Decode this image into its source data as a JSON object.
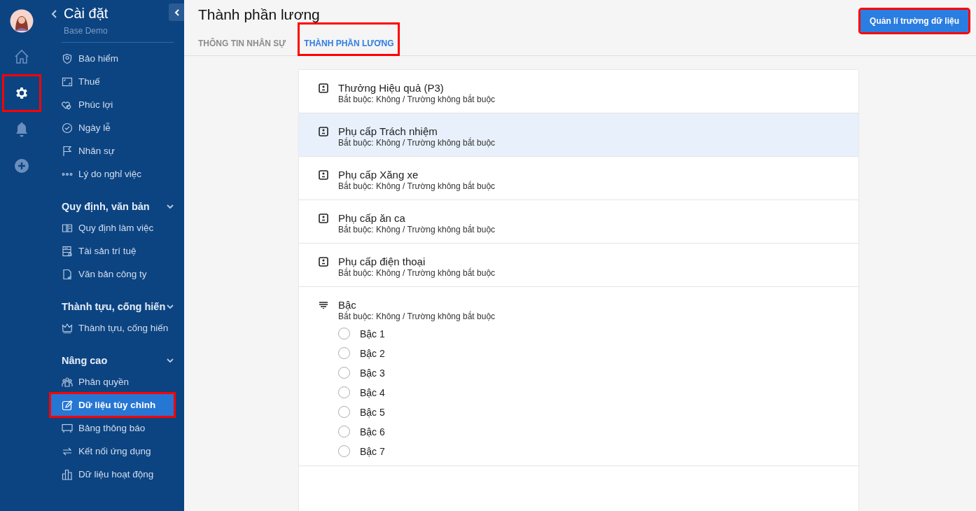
{
  "rail": {
    "items": [
      {
        "kind": "home",
        "selected": false,
        "highlighted": false
      },
      {
        "kind": "settings",
        "selected": true,
        "highlighted": true
      },
      {
        "kind": "bell",
        "selected": false,
        "highlighted": false
      },
      {
        "kind": "add",
        "selected": false,
        "highlighted": false
      }
    ]
  },
  "sidebar": {
    "title": "Cài đặt",
    "subtitle": "Base Demo",
    "sections": [
      {
        "items": [
          {
            "label": "Bảo hiểm",
            "kind": "shield",
            "selected": false,
            "highlighted": false
          },
          {
            "label": "Thuế",
            "kind": "frame",
            "selected": false,
            "highlighted": false
          },
          {
            "label": "Phúc lợi",
            "kind": "hearts",
            "selected": false,
            "highlighted": false
          },
          {
            "label": "Ngày lễ",
            "kind": "check",
            "selected": false,
            "highlighted": false
          },
          {
            "label": "Nhân sự",
            "kind": "flag",
            "selected": false,
            "highlighted": false
          },
          {
            "label": "Lý do nghỉ việc",
            "kind": "dots",
            "selected": false,
            "highlighted": false
          }
        ]
      },
      {
        "heading": "Quy định, văn bản",
        "expanded": true,
        "items": [
          {
            "label": "Quy định làm việc",
            "kind": "book",
            "selected": false,
            "highlighted": false
          },
          {
            "label": "Tài sản trí tuệ",
            "kind": "list",
            "selected": false,
            "highlighted": false
          },
          {
            "label": "Văn bản công ty",
            "kind": "doc",
            "selected": false,
            "highlighted": false
          }
        ]
      },
      {
        "heading": "Thành tựu, cống hiến",
        "expanded": true,
        "items": [
          {
            "label": "Thành tựu, cống hiến",
            "kind": "crown",
            "selected": false,
            "highlighted": false
          }
        ]
      },
      {
        "heading": "Nâng cao",
        "expanded": true,
        "items": [
          {
            "label": "Phân quyền",
            "kind": "people",
            "selected": false,
            "highlighted": false
          },
          {
            "label": "Dữ liệu tùy chỉnh",
            "kind": "edit",
            "selected": true,
            "highlighted": true
          },
          {
            "label": "Bảng thông báo",
            "kind": "board",
            "selected": false,
            "highlighted": false
          },
          {
            "label": "Kết nối ứng dụng",
            "kind": "swap",
            "selected": false,
            "highlighted": false
          },
          {
            "label": "Dữ liệu hoạt động",
            "kind": "bars",
            "selected": false,
            "highlighted": false
          }
        ]
      }
    ]
  },
  "header": {
    "title": "Thành phần lương",
    "tabs": [
      {
        "label": "THÔNG TIN NHÂN SỰ",
        "selected": false,
        "highlighted": false
      },
      {
        "label": "THÀNH PHẦN LƯƠNG",
        "selected": true,
        "highlighted": true
      }
    ],
    "button": {
      "label": "Quản lí trường dữ liệu",
      "highlighted": true
    }
  },
  "fields": [
    {
      "kind": "number",
      "name": "Thưởng Hiệu quả (P3)",
      "meta": "Bắt buộc: Không / Trường không bắt buộc",
      "selected": false
    },
    {
      "kind": "number",
      "name": "Phụ cấp Trách nhiệm",
      "meta": "Bắt buộc: Không / Trường không bắt buộc",
      "selected": true
    },
    {
      "kind": "number",
      "name": "Phụ cấp Xăng xe",
      "meta": "Bắt buộc: Không / Trường không bắt buộc",
      "selected": false
    },
    {
      "kind": "number",
      "name": "Phụ cấp ăn ca",
      "meta": "Bắt buộc: Không / Trường không bắt buộc",
      "selected": false
    },
    {
      "kind": "number",
      "name": "Phụ cấp điện thoại",
      "meta": "Bắt buộc: Không / Trường không bắt buộc",
      "selected": false
    },
    {
      "kind": "select",
      "name": "Bậc",
      "meta": "Bắt buộc: Không / Trường không bắt buộc",
      "selected": false,
      "options": [
        {
          "label": "Bậc 1",
          "checked": false
        },
        {
          "label": "Bậc 2",
          "checked": false
        },
        {
          "label": "Bậc 3",
          "checked": false
        },
        {
          "label": "Bậc 4",
          "checked": false
        },
        {
          "label": "Bậc 5",
          "checked": false
        },
        {
          "label": "Bậc 6",
          "checked": false
        },
        {
          "label": "Bậc 7",
          "checked": false
        }
      ]
    }
  ]
}
